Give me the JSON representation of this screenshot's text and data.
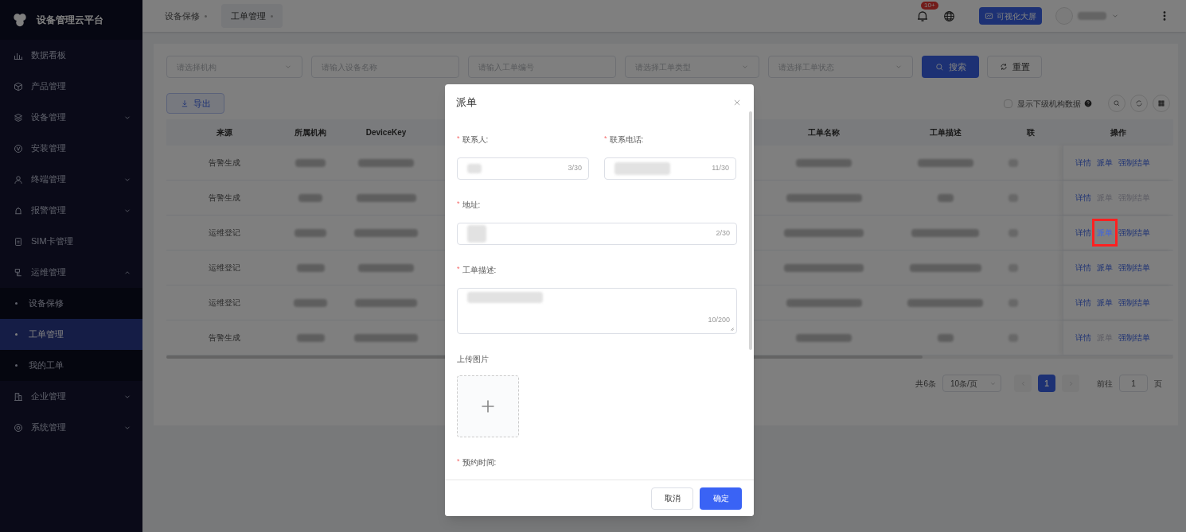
{
  "sidebar": {
    "logo_text": "设备管理云平台",
    "items": [
      {
        "label": "数据看板"
      },
      {
        "label": "产品管理"
      },
      {
        "label": "设备管理",
        "expanded": false
      },
      {
        "label": "安装管理"
      },
      {
        "label": "终端管理",
        "expanded": false
      },
      {
        "label": "报警管理",
        "expanded": false
      },
      {
        "label": "SIM卡管理"
      },
      {
        "label": "运维管理",
        "expanded": true,
        "children": [
          {
            "label": "设备保修",
            "selected": false
          },
          {
            "label": "工单管理",
            "selected": true
          },
          {
            "label": "我的工单",
            "selected": false
          }
        ]
      },
      {
        "label": "企业管理",
        "expanded": false
      },
      {
        "label": "系统管理",
        "expanded": false
      }
    ]
  },
  "top_bar": {
    "tabs": [
      {
        "label": "设备保修",
        "selected": false
      },
      {
        "label": "工单管理",
        "selected": true
      }
    ],
    "notification_badge": "10+",
    "dashboard_button": "可视化大屏"
  },
  "filters": {
    "fields": [
      {
        "kind": "select",
        "placeholder": "请选择机构"
      },
      {
        "kind": "input",
        "placeholder": "请输入设备名称"
      },
      {
        "kind": "input",
        "placeholder": "请输入工单编号"
      },
      {
        "kind": "select",
        "placeholder": "请选择工单类型"
      },
      {
        "kind": "select",
        "placeholder": "请选择工单状态"
      }
    ],
    "search_button": "搜索",
    "reset_button": "重置"
  },
  "toolbar": {
    "export_button": "导出",
    "sub_org_checkbox": {
      "label": "显示下级机构数据",
      "checked": false
    }
  },
  "table": {
    "columns": [
      "来源",
      "所属机构",
      "DeviceKey",
      "工单名称",
      "工单描述",
      "联",
      "操作"
    ],
    "rows": [
      {
        "source": "告警生成",
        "actions": [
          {
            "label": "详情",
            "disabled": false,
            "highlighted": false
          },
          {
            "label": "派单",
            "disabled": false,
            "highlighted": false
          },
          {
            "label": "强制结单",
            "disabled": false,
            "highlighted": false
          }
        ]
      },
      {
        "source": "告警生成",
        "actions": [
          {
            "label": "详情",
            "disabled": false,
            "highlighted": false
          },
          {
            "label": "派单",
            "disabled": true,
            "highlighted": false
          },
          {
            "label": "强制结单",
            "disabled": true,
            "highlighted": false
          }
        ]
      },
      {
        "source": "运维登记",
        "actions": [
          {
            "label": "详情",
            "disabled": false,
            "highlighted": false
          },
          {
            "label": "派单",
            "disabled": false,
            "highlighted": true
          },
          {
            "label": "强制结单",
            "disabled": false,
            "highlighted": false
          }
        ]
      },
      {
        "source": "运维登记",
        "actions": [
          {
            "label": "详情",
            "disabled": false,
            "highlighted": false
          },
          {
            "label": "派单",
            "disabled": false,
            "highlighted": false
          },
          {
            "label": "强制结单",
            "disabled": false,
            "highlighted": false
          }
        ]
      },
      {
        "source": "运维登记",
        "actions": [
          {
            "label": "详情",
            "disabled": false,
            "highlighted": false
          },
          {
            "label": "派单",
            "disabled": false,
            "highlighted": false
          },
          {
            "label": "强制结单",
            "disabled": false,
            "highlighted": false
          }
        ]
      },
      {
        "source": "告警生成",
        "actions": [
          {
            "label": "详情",
            "disabled": false,
            "highlighted": false
          },
          {
            "label": "派单",
            "disabled": true,
            "highlighted": false
          },
          {
            "label": "强制结单",
            "disabled": false,
            "highlighted": false
          }
        ]
      }
    ]
  },
  "pagination": {
    "total": "共6条",
    "page_size": "10条/页",
    "pages": [
      {
        "label": "1",
        "selected": true
      }
    ],
    "goto_label": "前往",
    "goto_value": "1",
    "page_suffix": "页"
  },
  "dialog": {
    "title": "派单",
    "fields": [
      {
        "kind": "input",
        "required_mark": "*",
        "label": "联系人:",
        "counter": "3/30"
      },
      {
        "kind": "input",
        "required_mark": "*",
        "label": "联系电话:",
        "counter": "11/30"
      },
      {
        "kind": "input",
        "required_mark": "*",
        "label": "地址:",
        "counter": "2/30"
      },
      {
        "kind": "textarea",
        "required_mark": "*",
        "label": "工单描述:",
        "counter": "10/200"
      },
      {
        "kind": "upload",
        "label": "上传图片"
      },
      {
        "kind": "label",
        "required_mark": "*",
        "label": "预约时间:"
      }
    ],
    "cancel_button": "取消",
    "confirm_button": "确定"
  }
}
